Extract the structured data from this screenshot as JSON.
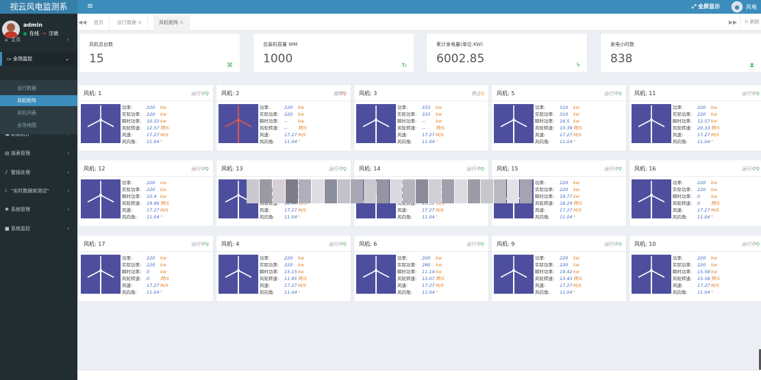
{
  "app": {
    "title": "视云风电监测系"
  },
  "header": {
    "fullscreen_label": "全屏显示",
    "user": "风电"
  },
  "sidebar": {
    "username": "admin",
    "online_label": "在线",
    "logout_label": "注销",
    "menu": [
      {
        "label": "主页",
        "icon": "home-icon"
      },
      {
        "label": "全场监控",
        "icon": "monitor-icon"
      },
      {
        "label": "数据统计",
        "icon": "cloud-icon"
      },
      {
        "label": "报表管理",
        "icon": "report-icon"
      },
      {
        "label": "警报处理",
        "icon": "bell-icon"
      },
      {
        "label": "\"实时数据库测试\"",
        "icon": "chart-icon"
      },
      {
        "label": "系统管理",
        "icon": "gear-icon"
      },
      {
        "label": "系统监控",
        "icon": "camera-icon"
      }
    ],
    "submenu": [
      "运行数据",
      "风机矩阵",
      "风机列表",
      "全场地图"
    ]
  },
  "tabs": {
    "items": [
      "首页",
      "运行数据",
      "风机矩阵"
    ],
    "refresh_label": "刷新"
  },
  "stats": [
    {
      "label": "风机总台数",
      "value": "15"
    },
    {
      "label": "总装机容量 WM",
      "value": "1000"
    },
    {
      "label": "累计发电量(单位:KW)",
      "value": "6002.85"
    },
    {
      "label": "发电小时数",
      "value": "838"
    }
  ],
  "field_labels": {
    "power": "功率:",
    "actual_power": "实际功率:",
    "instant_power": "瞬时功率:",
    "wheel_speed": "风轮转速:",
    "wind_speed": "风速:",
    "wind_dir": "风向角:"
  },
  "units": {
    "kw": "kw",
    "rpm": "转/S",
    "ms": "M/S",
    "deg": "°"
  },
  "turbines": [
    {
      "name": "风机: 1",
      "status": "运行中",
      "power": "220",
      "actual": "220",
      "instant": "10.33",
      "speed": "12.57",
      "wind": "17.27",
      "dir": "11.04"
    },
    {
      "name": "风机: 2",
      "status": "故障",
      "power": "220",
      "actual": "220",
      "instant": "--",
      "speed": "--",
      "wind": "17.27",
      "dir": "11.04"
    },
    {
      "name": "风机: 3",
      "status": "停止",
      "power": "333",
      "actual": "333",
      "instant": "--",
      "speed": "--",
      "wind": "17.27",
      "dir": "11.04"
    },
    {
      "name": "风机: 5",
      "status": "运行中",
      "power": "310",
      "actual": "310",
      "instant": "16.5",
      "speed": "10.39",
      "wind": "17.27",
      "dir": "11.04"
    },
    {
      "name": "风机: 11",
      "status": "运行中",
      "power": "220",
      "actual": "220",
      "instant": "12.57",
      "speed": "20.33",
      "wind": "17.27",
      "dir": "11.04"
    },
    {
      "name": "风机: 12",
      "status": "运行中",
      "power": "220",
      "actual": "220",
      "instant": "10.4",
      "speed": "19.96",
      "wind": "17.27",
      "dir": "11.04"
    },
    {
      "name": "风机: 13",
      "status": "运行中",
      "power": "",
      "actual": "",
      "instant": "",
      "speed": "18.44",
      "wind": "17.27",
      "dir": "11.04"
    },
    {
      "name": "风机: 14",
      "status": "运行中",
      "power": "",
      "actual": "",
      "instant": "",
      "speed": "15.51",
      "wind": "17.27",
      "dir": "11.04"
    },
    {
      "name": "风机: 15",
      "status": "运行中",
      "power": "220",
      "actual": "220",
      "instant": "19.77",
      "speed": "18.24",
      "wind": "17.27",
      "dir": "11.04"
    },
    {
      "name": "风机: 16",
      "status": "运行中",
      "power": "220",
      "actual": "220",
      "instant": "0",
      "speed": "0",
      "wind": "17.27",
      "dir": "11.04"
    },
    {
      "name": "风机: 17",
      "status": "运行中",
      "power": "220",
      "actual": "220",
      "instant": "0",
      "speed": "0",
      "wind": "17.27",
      "dir": "11.04"
    },
    {
      "name": "风机: 4",
      "status": "运行中",
      "power": "220",
      "actual": "220",
      "instant": "15.15",
      "speed": "11.95",
      "wind": "17.27",
      "dir": "11.04"
    },
    {
      "name": "风机: 6",
      "status": "运行中",
      "power": "200",
      "actual": "290",
      "instant": "11.14",
      "speed": "13.07",
      "wind": "17.27",
      "dir": "11.04"
    },
    {
      "name": "风机: 9",
      "status": "运行中",
      "power": "220",
      "actual": "220",
      "instant": "19.42",
      "speed": "13.43",
      "wind": "17.27",
      "dir": "11.04"
    },
    {
      "name": "风机: 10",
      "status": "运行中",
      "power": "220",
      "actual": "220",
      "instant": "15.58",
      "speed": "15.58",
      "wind": "17.27",
      "dir": "11.04"
    }
  ],
  "colors": {
    "header": "#3c8dbc",
    "sidebar": "#222d32",
    "running": "#3ab54a",
    "fault": "#dd4b39",
    "stopped": "#f39c12",
    "turbine_bg": "#4d4f9e"
  }
}
